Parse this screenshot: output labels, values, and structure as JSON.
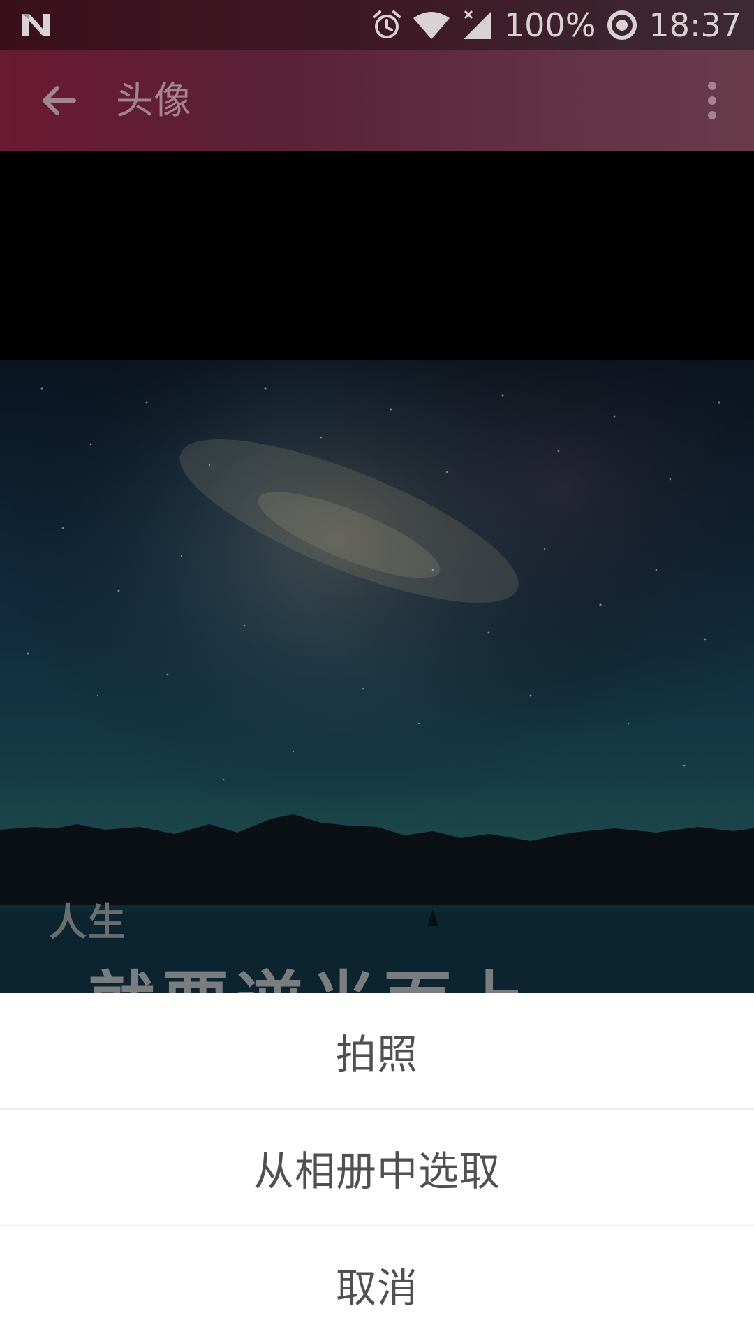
{
  "status_bar": {
    "battery": "100%",
    "time": "18:37",
    "icons": [
      "android-n-icon",
      "alarm-icon",
      "wifi-icon",
      "signal-icon",
      "data-saver-icon"
    ]
  },
  "app_bar": {
    "title": "头像",
    "back_icon": "arrow-back-icon",
    "more_icon": "more-vert-icon"
  },
  "image": {
    "caption_small": "人生",
    "caption_large": "就要逆光而上"
  },
  "bottom_sheet": {
    "items": [
      {
        "label": "拍照"
      },
      {
        "label": "从相册中选取"
      },
      {
        "label": "取消"
      }
    ]
  },
  "colors": {
    "status_bar": "#3a0f1c",
    "app_bar": "#6a1a33",
    "sheet_background": "#ffffff",
    "sheet_text": "#505050"
  }
}
